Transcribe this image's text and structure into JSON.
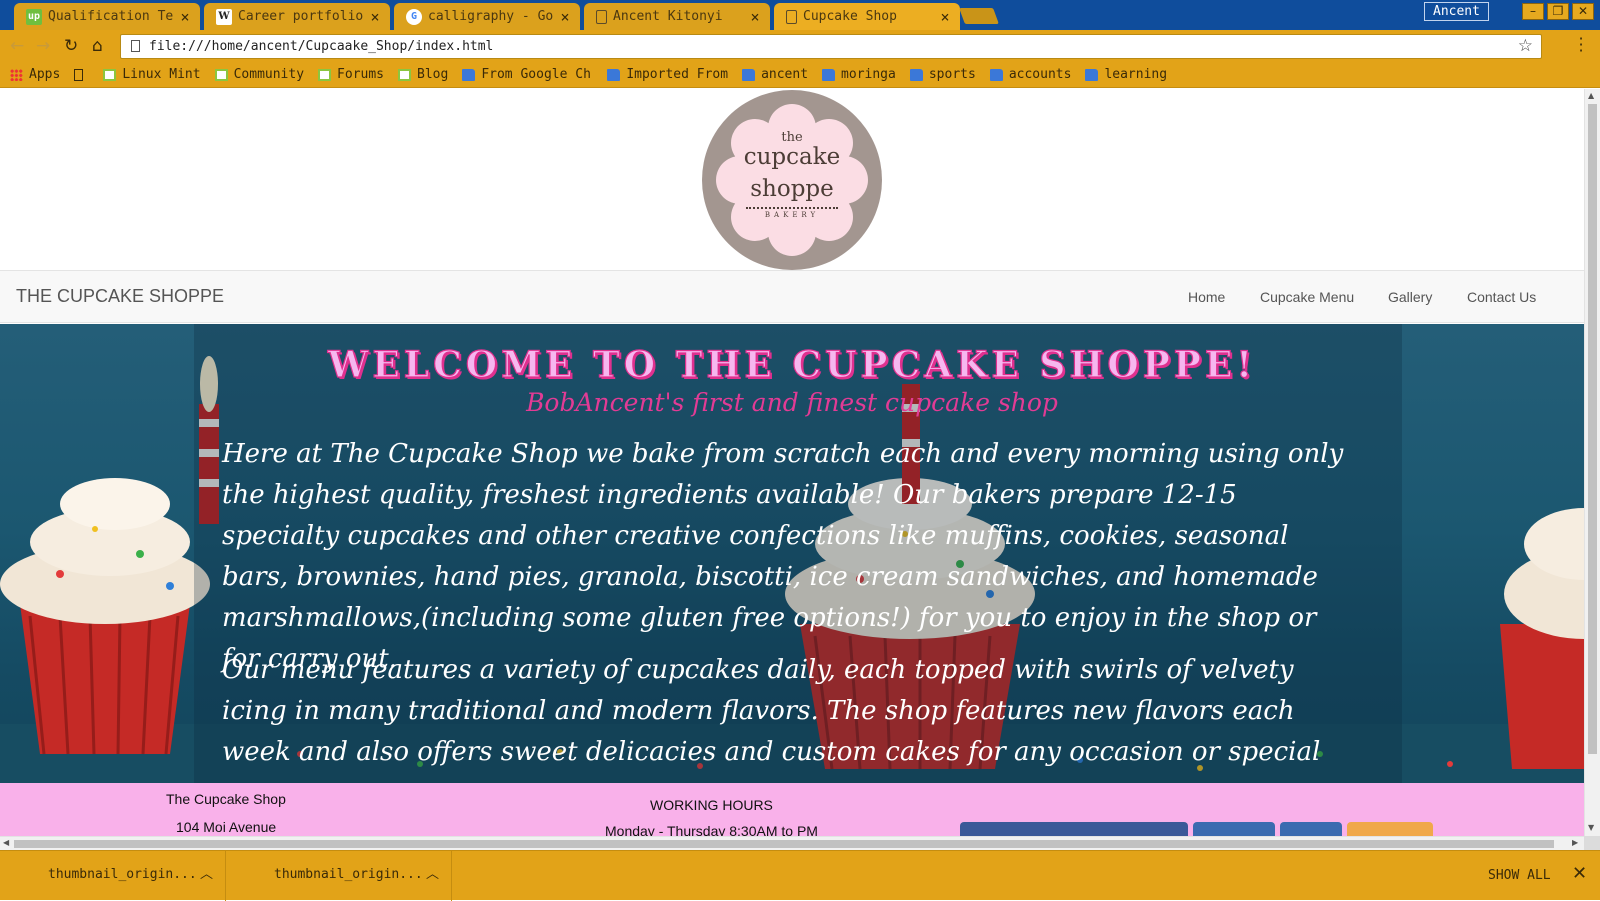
{
  "browser": {
    "tabs": [
      {
        "label": "Qualification Te",
        "favicon": "upwork-icon"
      },
      {
        "label": "Career portfolio",
        "favicon": "wikipedia-icon"
      },
      {
        "label": "calligraphy - Go",
        "favicon": "google-icon"
      },
      {
        "label": "Ancent Kitonyi",
        "favicon": "page-icon"
      },
      {
        "label": "Cupcake Shop",
        "favicon": "page-icon"
      }
    ],
    "profile_name": "Ancent",
    "url": "file:///home/ancent/Cupcaake_Shop/index.html",
    "bookmarks": [
      {
        "label": "Apps",
        "icon": "apps-grid-icon"
      },
      {
        "label": "",
        "icon": "page-icon"
      },
      {
        "label": "Linux Mint",
        "icon": "mint-icon"
      },
      {
        "label": "Community",
        "icon": "mint-icon"
      },
      {
        "label": "Forums",
        "icon": "mint-icon"
      },
      {
        "label": "Blog",
        "icon": "mint-icon"
      },
      {
        "label": "From Google Ch",
        "icon": "folder-icon"
      },
      {
        "label": "Imported From",
        "icon": "folder-icon"
      },
      {
        "label": "ancent",
        "icon": "folder-icon"
      },
      {
        "label": "moringa",
        "icon": "folder-icon"
      },
      {
        "label": "sports",
        "icon": "folder-icon"
      },
      {
        "label": "accounts",
        "icon": "folder-icon"
      },
      {
        "label": "learning",
        "icon": "folder-icon"
      }
    ],
    "downloads": [
      {
        "name": "thumbnail_origin..."
      },
      {
        "name": "thumbnail_origin..."
      }
    ],
    "show_all_label": "SHOW ALL",
    "colors": {
      "tabbar": "#0f4d9c",
      "chrome": "#e2a318"
    }
  },
  "page": {
    "logo": {
      "the": "the",
      "line1": "cupcake",
      "line2": "shoppe",
      "bakery": "BAKERY"
    },
    "nav": {
      "brand": "THE CUPCAKE SHOPPE",
      "links": [
        "Home",
        "Cupcake Menu",
        "Gallery",
        "Contact Us"
      ]
    },
    "hero": {
      "title": "WELCOME TO THE CUPCAKE SHOPPE!",
      "subtitle": "BobAncent's first and finest cupcake shop",
      "p1": {
        "a": "Here at The Cupcake Shop we bake from scratch each and every morning using only the highest quality, freshest ingredients available! Our bakers prepare ",
        "b": "12-15 specialty cupcakes",
        "c": " and other creative confections like ",
        "d": "muffins, cookies, seasonal bars, brownies, hand pies, granola, biscotti, ice cream sandwiches,",
        "e": " and ",
        "f": "homemade marshmallows,",
        "g": "(including some gluten free options!) for you to enjoy in the shop or for carry out."
      },
      "p2": "Our menu features a variety of cupcakes daily, each topped with swirls of velvety icing in many traditional and modern flavors. The shop features new flavors each week and also offers sweet delicacies and custom cakes for any occasion or special event"
    },
    "footer": {
      "name": "The Cupcake Shop",
      "street": "104 Moi Avenue",
      "hours_title": "WORKING HOURS",
      "hours_line": "Monday - Thursday 8:30AM to PM"
    },
    "colors": {
      "title_pink": "#e0308f",
      "footer_pink": "#f9b1ea",
      "hero_blue": "#1b5770"
    }
  }
}
